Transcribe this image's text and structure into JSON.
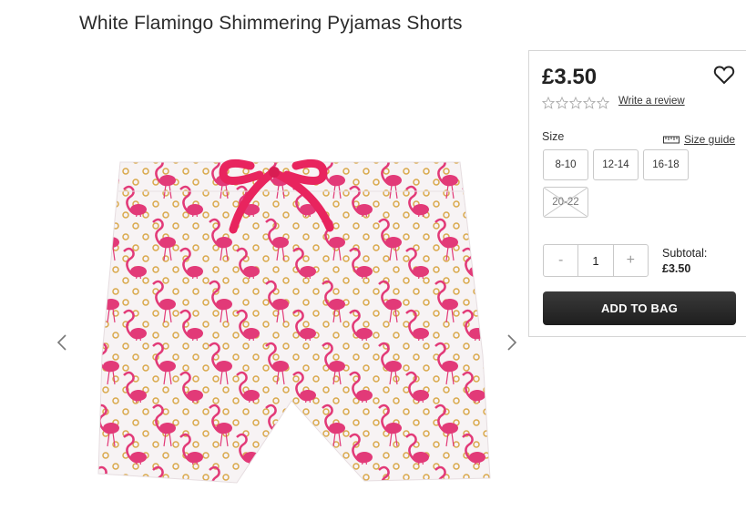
{
  "product": {
    "title": "White Flamingo Shimmering Pyjamas Shorts",
    "price": "£3.50",
    "review_link": "Write a review",
    "rating_stars": 5,
    "accent_color": "#e8245e"
  },
  "size": {
    "label": "Size",
    "guide_label": "Size guide",
    "options": [
      {
        "label": "8-10",
        "available": true
      },
      {
        "label": "12-14",
        "available": true
      },
      {
        "label": "16-18",
        "available": true
      },
      {
        "label": "20-22",
        "available": false
      }
    ]
  },
  "quantity": {
    "minus": "-",
    "value": "1",
    "plus": "+"
  },
  "subtotal": {
    "label": "Subtotal:",
    "value": "£3.50"
  },
  "cta": {
    "add_to_bag": "ADD TO BAG"
  },
  "icons": {
    "prev": "chevron-left-icon",
    "next": "chevron-right-icon",
    "wishlist": "heart-icon",
    "size_guide": "ruler-icon"
  }
}
